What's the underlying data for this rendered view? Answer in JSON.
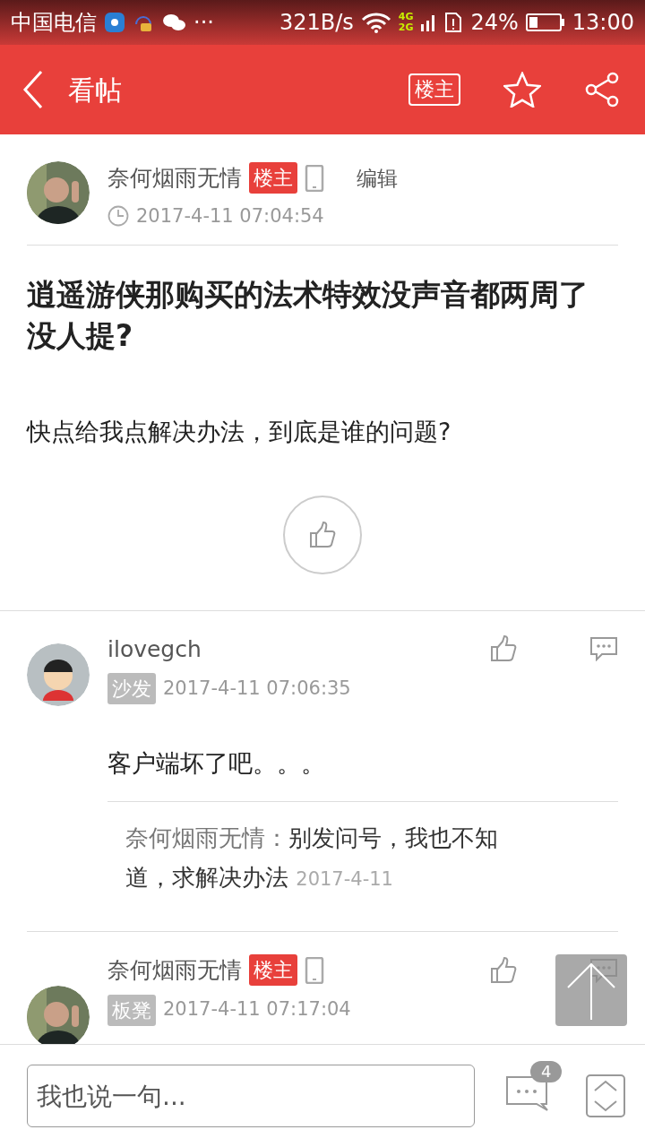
{
  "status_bar": {
    "carrier": "中国电信",
    "more": "···",
    "speed": "321B/s",
    "network_top": "4G",
    "network_bottom": "2G",
    "battery": "24%",
    "time": "13:00"
  },
  "header": {
    "title": "看帖",
    "owner_filter": "楼主"
  },
  "post": {
    "author": "奈何烟雨无情",
    "badge": "楼主",
    "mobile": true,
    "edit": "编辑",
    "time": "2017-4-11 07:04:54",
    "title": "逍遥游侠那购买的法术特效没声音都两周了没人提?",
    "body": "快点给我点解决办法，到底是谁的问题?"
  },
  "replies": [
    {
      "avatar": {
        "kind": "cartoon"
      },
      "author": "ilovegch",
      "mobile": false,
      "floor": "沙发",
      "time": "2017-4-11 07:06:35",
      "body": "客户端坏了吧。。。",
      "sub_replies": [
        {
          "author": "奈何烟雨无情：",
          "text": "别发问号，我也不知道，求解决办法",
          "time": "2017-4-11"
        }
      ]
    },
    {
      "avatar": {
        "kind": "photo"
      },
      "author": "奈何烟雨无情",
      "badge": "楼主",
      "mobile": true,
      "floor": "板凳",
      "time": "2017-4-11 07:17:04"
    }
  ],
  "composer": {
    "placeholder": "我也说一句...",
    "comment_count": "4"
  }
}
